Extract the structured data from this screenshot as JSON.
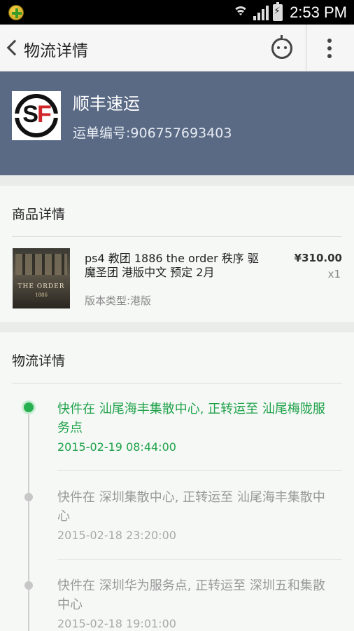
{
  "status_bar": {
    "time": "2:53 PM"
  },
  "action_bar": {
    "title": "物流详情"
  },
  "courier": {
    "name": "顺丰速运",
    "waybill": "运单编号:906757693403",
    "logo_text": "SF"
  },
  "product_section": {
    "header": "商品详情",
    "cover_title": "THE ORDER",
    "cover_subtitle": "1886",
    "name": "ps4 教团 1886 the order 秩序 驱魔圣团 港版中文 预定 2月",
    "price": "¥310.00",
    "quantity": "x1",
    "variant": "版本类型:港版"
  },
  "logistics_section": {
    "header": "物流详情",
    "events": [
      {
        "text": "快件在 汕尾海丰集散中心, 正转运至 汕尾梅陇服务点",
        "time": "2015-02-19 08:44:00",
        "current": true
      },
      {
        "text": "快件在 深圳集散中心, 正转运至 汕尾海丰集散中心",
        "time": "2015-02-18 23:20:00",
        "current": false
      },
      {
        "text": "快件在 深圳华为服务点, 正转运至 深圳五和集散中心",
        "time": "2015-02-18 19:01:00",
        "current": false
      }
    ]
  },
  "colors": {
    "header_bg": "#5a6a85",
    "accent_green": "#1fa24a"
  }
}
